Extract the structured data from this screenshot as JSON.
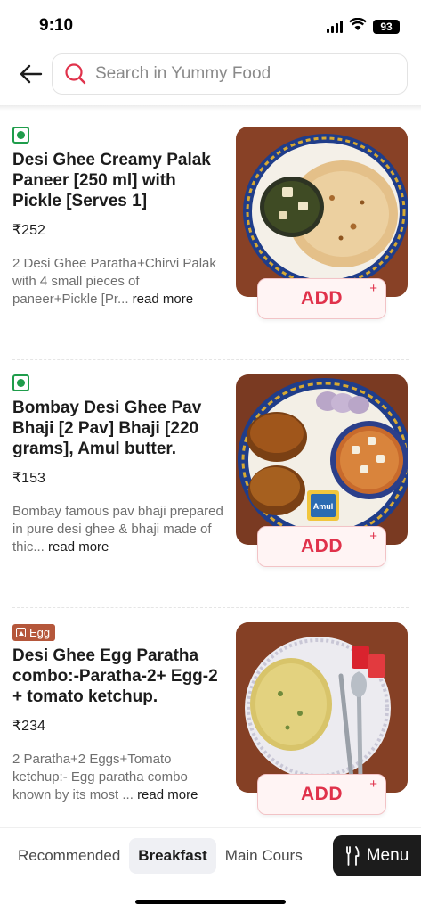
{
  "status_bar": {
    "time": "9:10",
    "battery": "93",
    "icons": [
      "cellular-signal-icon",
      "wifi-icon",
      "battery-icon"
    ]
  },
  "header": {
    "back_icon": "back-arrow-icon",
    "search_icon": "search-icon",
    "search_placeholder": "Search in Yummy Food",
    "search_value": ""
  },
  "items": [
    {
      "diet": "veg",
      "name": "Desi Ghee Creamy Palak Paneer [250 ml] with Pickle [Serves 1]",
      "price": "₹252",
      "description": "2 Desi Ghee Paratha+Chirvi Palak with 4 small pieces of paneer+Pickle [Pr...",
      "read_more": "read more",
      "add_label": "ADD",
      "add_plus": "+"
    },
    {
      "diet": "veg",
      "name": "Bombay Desi Ghee Pav Bhaji [2 Pav] Bhaji [220 grams], Amul butter.",
      "price": "₹153",
      "description": "Bombay famous pav bhaji prepared in pure desi ghee & bhaji made of thic...",
      "read_more": "read more",
      "add_label": "ADD",
      "add_plus": "+",
      "image_text": "Amul"
    },
    {
      "diet": "egg",
      "tag_label": "Egg",
      "name": "Desi Ghee Egg Paratha combo:-Paratha-2+ Egg-2 + tomato ketchup.",
      "price": "₹234",
      "description": "2 Paratha+2 Eggs+Tomato ketchup:- Egg paratha combo known by its most ...",
      "read_more": "read more",
      "add_label": "ADD",
      "add_plus": "+"
    }
  ],
  "bottom_tabs": [
    {
      "label": "Recommended",
      "active": false
    },
    {
      "label": "Breakfast",
      "active": true
    },
    {
      "label": "Main Cours",
      "active": false
    }
  ],
  "menu_button": {
    "label": "Menu",
    "icon": "fork-knife-icon"
  },
  "colors": {
    "accent": "#e0324b",
    "veg_green": "#1f9d4b",
    "egg_brown": "#b5573b",
    "menu_bg": "#1c1c1c"
  }
}
